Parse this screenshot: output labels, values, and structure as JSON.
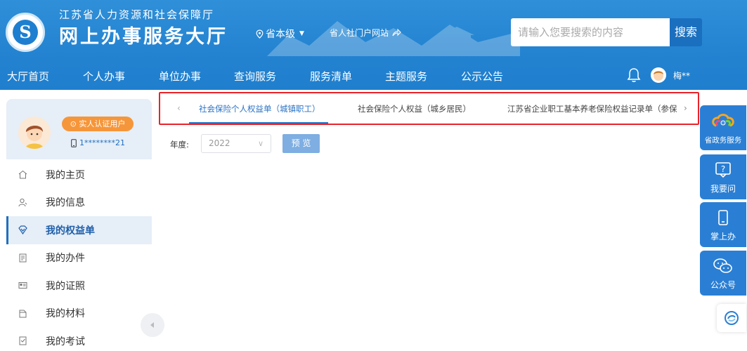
{
  "header": {
    "org_title": "江苏省人力资源和社会保障厅",
    "site_title": "网上办事服务大厅",
    "region": "省本级",
    "portal_link": "省人社门户网站",
    "search_placeholder": "请输入您要搜索的内容",
    "search_button": "搜索",
    "user_name": "梅**"
  },
  "nav": {
    "items": [
      "大厅首页",
      "个人办事",
      "单位办事",
      "查询服务",
      "服务清单",
      "主题服务",
      "公示公告"
    ]
  },
  "sidebar": {
    "badge": "实人认证用户",
    "phone": "1********21",
    "menu": [
      "我的主页",
      "我的信息",
      "我的权益单",
      "我的办件",
      "我的证照",
      "我的材料",
      "我的考试"
    ],
    "active_index": 2
  },
  "tabs": {
    "items": [
      "社会保险个人权益单（城镇职工）",
      "社会保险个人权益（城乡居民）",
      "江苏省企业职工基本养老保险权益记录单（参保"
    ],
    "active_index": 0
  },
  "filter": {
    "year_label": "年度:",
    "year_value": "2022",
    "preview_button": "预 览"
  },
  "side_panel": {
    "items": [
      "省政务服务",
      "我要问",
      "掌上办",
      "公众号"
    ]
  },
  "colors": {
    "header_bg": "#2383d1",
    "accent": "#2a73c5",
    "badge": "#f6963a",
    "highlight_border": "#e8232a"
  }
}
